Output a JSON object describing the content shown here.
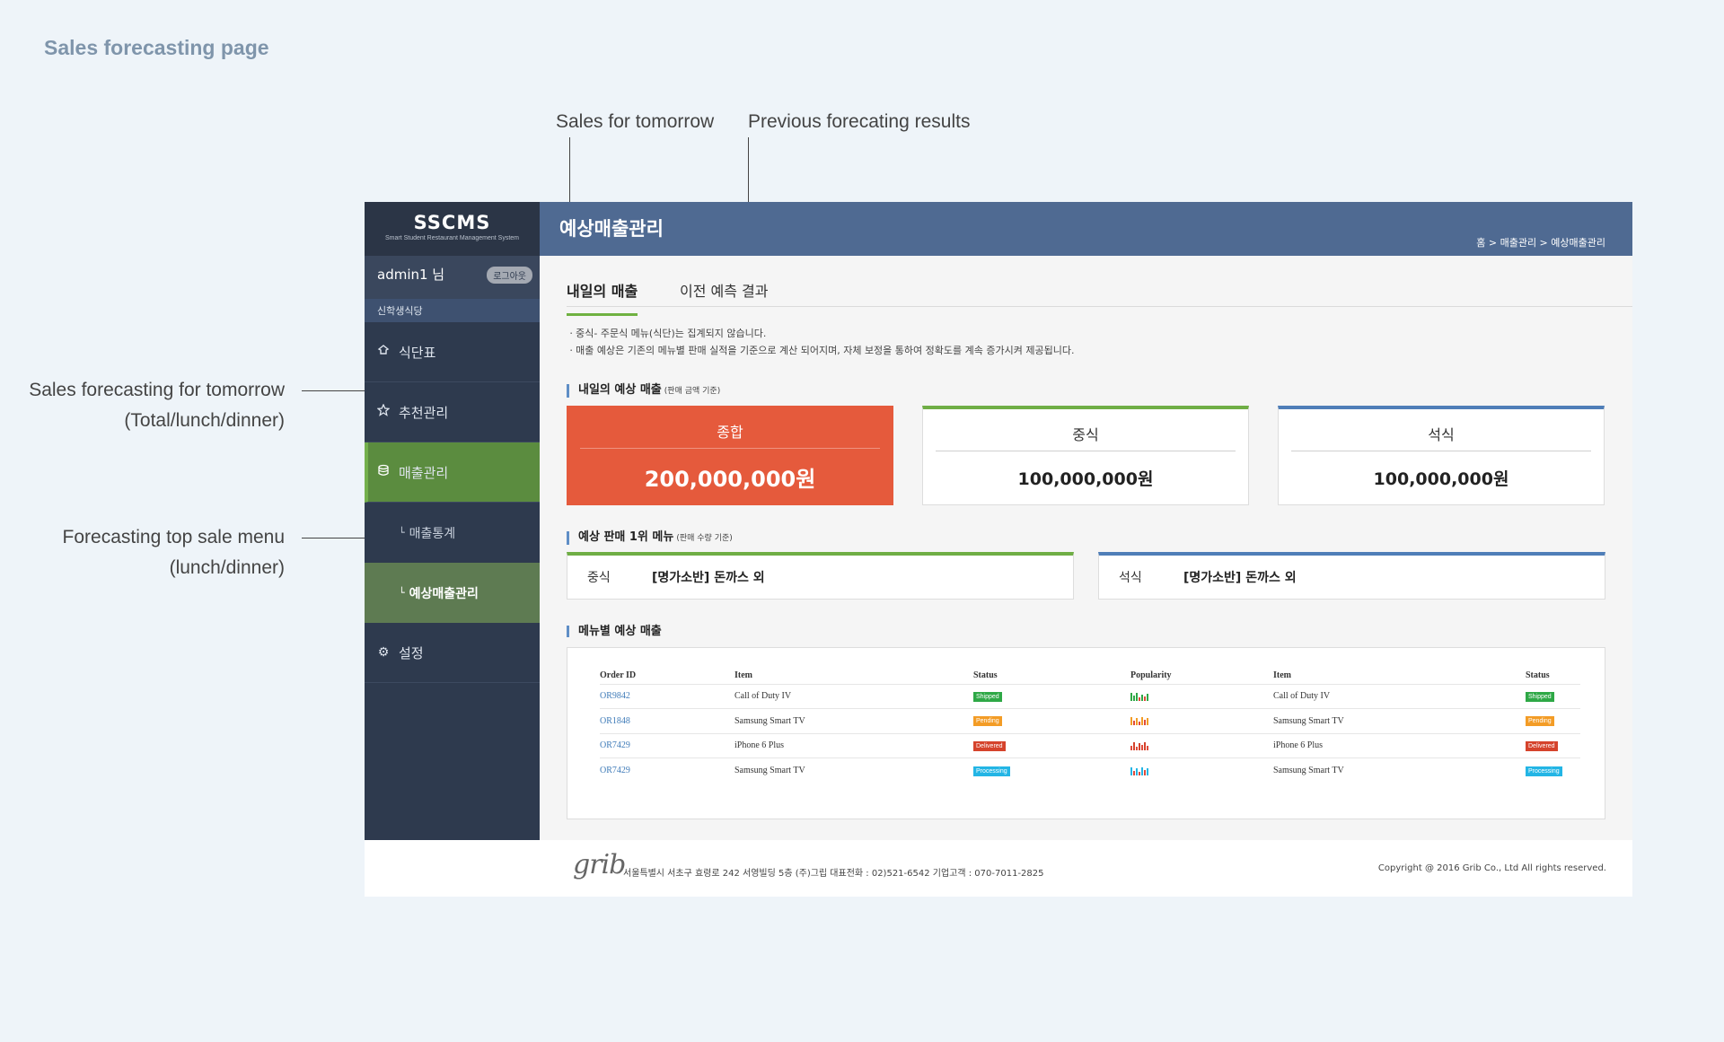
{
  "page_heading": "Sales forecasting page",
  "annotations": {
    "sales_tomorrow": "Sales for tomorrow",
    "previous_results": "Previous forecating results",
    "forecast_line1": "Sales forecasting for tomorrow",
    "forecast_line2": "(Total/lunch/dinner)",
    "top_menu_line1": "Forecasting top sale menu",
    "top_menu_line2": "(lunch/dinner)"
  },
  "sidebar": {
    "brand": "SSCMS",
    "brand_sub": "Smart Student Restaurant Management System",
    "user": "admin1 님",
    "logout": "로그아웃",
    "place": "신학생식당",
    "items": [
      {
        "label": "식단표",
        "icon": "cap-icon"
      },
      {
        "label": "추천관리",
        "icon": "star-icon"
      },
      {
        "label": "매출관리",
        "icon": "database-icon"
      },
      {
        "label": "설정",
        "icon": "gear-icon"
      }
    ],
    "subitems": [
      {
        "label": "매출통계"
      },
      {
        "label": "예상매출관리"
      }
    ]
  },
  "header": {
    "title": "예상매출관리",
    "breadcrumb": "홈 > 매출관리 > 예상매출관리"
  },
  "tabs": [
    {
      "label": "내일의 매출"
    },
    {
      "label": "이전 예측 결과"
    }
  ],
  "notes": [
    "ㆍ중식- 주문식 메뉴(식단)는 집계되지 않습니다.",
    "ㆍ매출 예상은 기존의 메뉴별 판매 실적을 기준으로 계산 되어지며, 자체 보정을 통하여 정확도를 계속 증가시켜 제공됩니다."
  ],
  "forecast_section": {
    "title": "내일의 예상 매출",
    "sub": "(판매 금액 기준)"
  },
  "cards": [
    {
      "label": "종합",
      "value": "200,000,000원"
    },
    {
      "label": "중식",
      "value": "100,000,000원"
    },
    {
      "label": "석식",
      "value": "100,000,000원"
    }
  ],
  "top_menu_section": {
    "title": "예상 판매 1위 메뉴",
    "sub": "(판매 수량 기준)"
  },
  "top_menus": [
    {
      "meal": "중식",
      "menu": "[명가소반] 돈까스 외"
    },
    {
      "meal": "석식",
      "menu": "[명가소반] 돈까스 외"
    }
  ],
  "menu_section": {
    "title": "메뉴별 예상 매출"
  },
  "table": {
    "headers": [
      "Order ID",
      "Item",
      "Status",
      "Popularity",
      "Item",
      "Status"
    ],
    "rows": [
      {
        "id": "OR9842",
        "item": "Call of Duty IV",
        "status": "Shipped",
        "item2": "Call of Duty IV",
        "status2": "Shipped"
      },
      {
        "id": "OR1848",
        "item": "Samsung Smart TV",
        "status": "Pending",
        "item2": "Samsung Smart TV",
        "status2": "Pending"
      },
      {
        "id": "OR7429",
        "item": "iPhone 6 Plus",
        "status": "Delivered",
        "item2": "iPhone 6 Plus",
        "status2": "Delivered"
      },
      {
        "id": "OR7429",
        "item": "Samsung Smart TV",
        "status": "Processing",
        "item2": "Samsung Smart TV",
        "status2": "Processing"
      }
    ]
  },
  "footer": {
    "logo": "grib",
    "address": "서울특별시 서초구 효령로 242 서영빌딩 5층 (주)그립 대표전화 : 02)521-6542 기업고객 : 070-7011-2825",
    "copyright": "Copyright @ 2016 Grib Co., Ltd All rights reserved."
  },
  "colors": {
    "header": "#4f6a92",
    "sidebar": "#2e3a4e",
    "total_card": "#e55a3c",
    "lunch": "#6fae45",
    "dinner": "#4f7eb8"
  }
}
